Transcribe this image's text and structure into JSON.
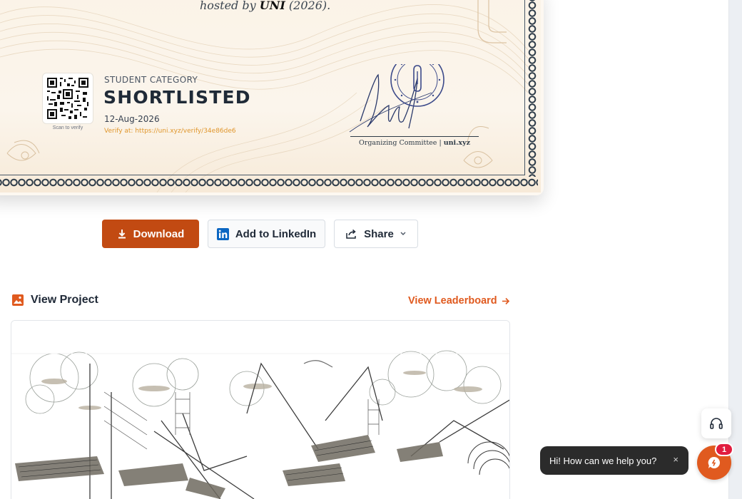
{
  "certificate": {
    "hosted_text": "hosted by",
    "host_name": "UNI",
    "year_text": "(2026).",
    "qr_caption": "Scan to verify",
    "category_label": "STUDENT CATEGORY",
    "status": "SHORTLISTED",
    "date": "12-Aug-2026",
    "verify_text": "Verify at: https://uni.xyz/verify/34e86de6",
    "committee_text": "Organizing Committee",
    "committee_site": "uni.xyz",
    "accent_color": "#e0962b",
    "border_color": "#2f3d4a"
  },
  "actions": {
    "download_label": "Download",
    "linkedin_label": "Add to LinkedIn",
    "share_label": "Share",
    "download_color": "#c24a12"
  },
  "project": {
    "title": "View Project",
    "leaderboard_label": "View Leaderboard",
    "accent_color": "#e05a1f"
  },
  "support": {
    "chat_prompt": "Hi! How can we help you?",
    "close_glyph": "×",
    "badge_count": "1"
  },
  "icons": {
    "download": "download-icon",
    "linkedin": "linkedin-icon",
    "share": "share-icon",
    "chevron": "chevron-down-icon",
    "image": "image-icon",
    "arrow": "arrow-right-icon",
    "headset": "headset-icon",
    "chat": "chat-icon"
  }
}
